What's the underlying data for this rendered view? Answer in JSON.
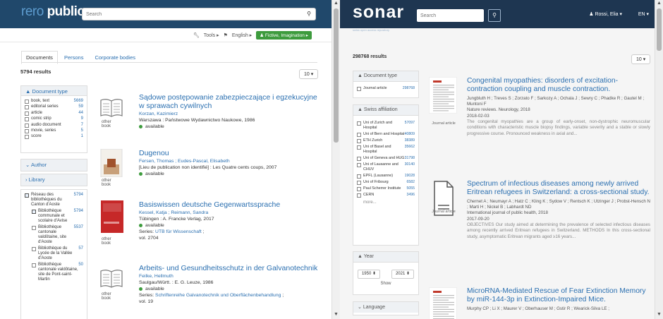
{
  "left": {
    "logo_a": "rero",
    "logo_b": " public",
    "search_placeholder": "Search",
    "tools": {
      "tools": "Tools ▸",
      "lang": "English ▸",
      "org": "♟ Fictive, Imagination ▸"
    },
    "tabs": [
      "Documents",
      "Persons",
      "Corporate bodies"
    ],
    "results": "5794 results",
    "per_page": "10 ▾",
    "doc_type": {
      "title": "Document type",
      "items": [
        {
          "label": "book, text",
          "count": "5669"
        },
        {
          "label": "editorial series",
          "count": "59"
        },
        {
          "label": "article",
          "count": "44"
        },
        {
          "label": "comic strip",
          "count": "9"
        },
        {
          "label": "audio document",
          "count": "7"
        },
        {
          "label": "movie, series",
          "count": "5"
        },
        {
          "label": "score",
          "count": "1"
        }
      ]
    },
    "author": "Author",
    "library": "Library",
    "libraries": [
      {
        "label": "Réseau des bibliothèques du Canton d'Aoste",
        "count": "5794",
        "on": true,
        "indent": false
      },
      {
        "label": "Bibliothèque communale et scolaire d'Avise",
        "count": "5794",
        "on": true,
        "indent": true
      },
      {
        "label": "Bibliothèque cantonale valdôtaine, site d'Aoste",
        "count": "5537",
        "on": false,
        "indent": true
      },
      {
        "label": "Bibliothèque du Lycée de la Vallée d'Aoste",
        "count": "57",
        "on": false,
        "indent": true
      },
      {
        "label": "Bibliothèque cantonale valdôtaine, site de Pont-saint-Martin",
        "count": "50",
        "on": false,
        "indent": true
      }
    ],
    "records": [
      {
        "title": "Sądowe postępowanie zabezpieczające i egzekucyjne w sprawach cywilnych",
        "type": "other book",
        "author": "Korzan, Kazimierz",
        "pub": "Warszawa : Państwowe Wydawnictwo Naukowe, 1986",
        "avail": "available"
      },
      {
        "title": "Dugenou",
        "type": "other book",
        "author": "Fersen, Thomas ; Eudes-Pascal, Elisabeth",
        "pub": "[Lieu de publication non identifié] : Les Quatre cents coups, 2007",
        "avail": "available"
      },
      {
        "title": "Basiswissen deutsche Gegenwartssprache",
        "type": "other book",
        "author": "Kessel, Katja ; Reimann, Sandra",
        "pub": "Tübingen : A. Francke Verlag, 2017",
        "avail": "available",
        "series_lbl": "Series: ",
        "series": "UTB für Wissenschaft",
        "series_tail": " ;",
        "vol": "vol. 2704"
      },
      {
        "title": "Arbeits- und Gesundheitsschutz in der Galvanotechnik",
        "type": "other book",
        "author": "Feilke, Hellmuth",
        "pub": "Saulgau/Württ. : E. G. Leuze, 1986",
        "avail": "available",
        "series_lbl": "Series: ",
        "series": "Schriftenreihe Galvanotechnik und Oberflächenbehandlung",
        "series_tail": " ;",
        "vol": "vol. 19"
      }
    ]
  },
  "right": {
    "logo": "sonar",
    "logo_sub": "swiss open access repository",
    "search_placeholder": "Search",
    "user": "♟ Rossi, Elia ▾",
    "lang": "EN ▾",
    "results": "298768 results",
    "per_page": "10 ▾",
    "doc_type": {
      "title": "Document type",
      "items": [
        {
          "label": "Journal article",
          "count": "298768"
        }
      ]
    },
    "affil": {
      "title": "Swiss affiliation",
      "items": [
        {
          "label": "Uni of Zurich and Hospital",
          "count": "57097"
        },
        {
          "label": "Uni of Bern and Hospital",
          "count": "40809"
        },
        {
          "label": "ETH Zurich",
          "count": "38389"
        },
        {
          "label": "Uni of Basel and Hospital",
          "count": "35662"
        },
        {
          "label": "Uni of Geneva and HUG",
          "count": "31798"
        },
        {
          "label": "Uni of Lausanne and CHUV",
          "count": "30140"
        },
        {
          "label": "EPFL (Lausanne)",
          "count": "19028"
        },
        {
          "label": "Uni of Fribourg",
          "count": "6582"
        },
        {
          "label": "Paul Scherrer Institute",
          "count": "5055"
        },
        {
          "label": "CERN",
          "count": "3496"
        }
      ],
      "more": "more..."
    },
    "year": {
      "title": "Year",
      "from": "1950 ⬍",
      "to": "2021 ⬍",
      "show": "Show"
    },
    "language": "Language",
    "records": [
      {
        "title": "Congenital myopathies: disorders of excitation-contraction coupling and muscle contraction.",
        "type": "Journal article",
        "authors": "Jungbluth H ; Treves S ; Zorzato F ; Sarkozy A ; Ochala J ; Sewry C ; Phadke R ; Gautel M ; Muntoni F",
        "journal": "Nature reviews. Neurology, 2018",
        "date": "2018-02-03",
        "abstract": "The congenital myopathies are a group of early-onset, non-dystrophic neuromuscular conditions with characteristic muscle biopsy findings, variable severity and a stable or slowly progressive course. Pronounced weakness in axial and..."
      },
      {
        "title": "Spectrum of infectious diseases among newly arrived Eritrean refugees in Switzerland: a cross-sectional study.",
        "type": "Journal article",
        "authors": "Chernet A ; Neumayr A ; Hatz C ; Kling K ; Sydow V ; Rentsch K ; Utzinger J ; Probst-Hensch N ; Marti H ; Nickel B ; Labhardt ND",
        "journal": "International journal of public health, 2018",
        "date": "2017-09-20",
        "abstract": "OBJECTIVES Our study aimed at determining the prevalence of selected infectious diseases among recently arrived Eritrean refugees in Switzerland. METHODS In this cross-sectional study, asymptomatic Eritrean migrants aged ≥16 years..."
      },
      {
        "title": "MicroRNA-Mediated Rescue of Fear Extinction Memory by miR-144-3p in Extinction-Impaired Mice.",
        "type": "",
        "authors": "Murphy CP ; Li X ; Maurer V ; Oberhauser M ; Gstir R ; Wearick-Silva LE ;",
        "journal": "",
        "date": "",
        "abstract": ""
      }
    ]
  }
}
